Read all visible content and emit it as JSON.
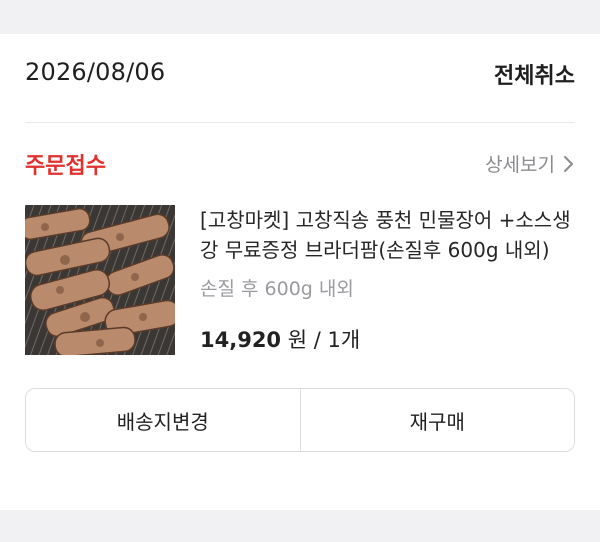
{
  "order": {
    "date": "2026/08/06",
    "cancel_all_label": "전체취소",
    "status": "주문접수",
    "detail_label": "상세보기"
  },
  "product": {
    "title": "[고창마켓] 고창직송 풍천 민물장어 +소스생강 무료증정 브라더팜(손질후 600g 내외)",
    "option": "손질 후 600g 내외",
    "price": "14,920",
    "currency": "원",
    "quantity": "1개",
    "image_icon": "grilled-eel-image"
  },
  "actions": {
    "change_address_label": "배송지변경",
    "reorder_label": "재구매"
  },
  "colors": {
    "status_red": "#e0312f",
    "band_gray": "#f1f1f3",
    "muted_text": "#8b8b90"
  }
}
